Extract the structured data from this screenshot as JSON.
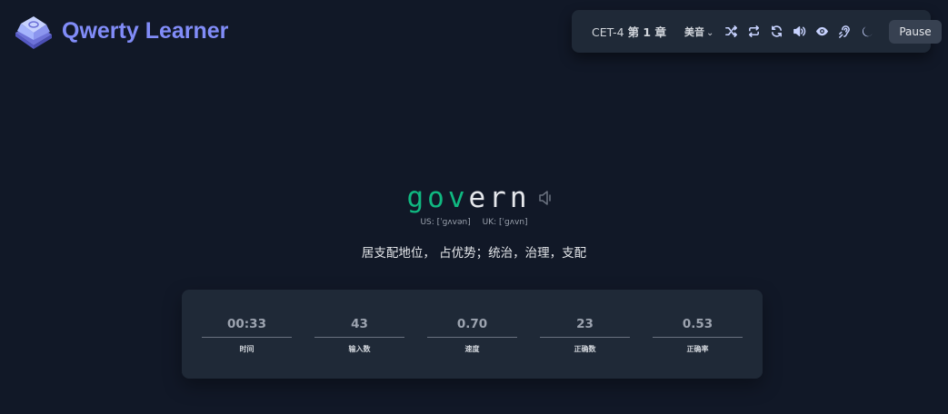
{
  "app": {
    "name": "Qwerty Learner",
    "accent_color": "#818cf8"
  },
  "toolbar": {
    "dictionary": "CET-4",
    "chapter": "第 1 章",
    "accent_label": "美音",
    "icons": [
      "shuffle-icon",
      "repeat-icon",
      "refresh-icon",
      "volume-icon",
      "eye-icon",
      "ear-icon",
      "moon-icon"
    ],
    "pause_label": "Pause"
  },
  "word": {
    "typed": "gov",
    "rest": "ern",
    "us_phonetic": "US: [ˈɡʌvən]",
    "uk_phonetic": "UK: [ˈɡʌvn]",
    "translation": "居支配地位， 占优势；统治，治理，支配",
    "typed_color": "#10b981"
  },
  "stats": [
    {
      "value": "00:33",
      "label": "时间"
    },
    {
      "value": "43",
      "label": "输入数"
    },
    {
      "value": "0.70",
      "label": "速度"
    },
    {
      "value": "23",
      "label": "正确数"
    },
    {
      "value": "0.53",
      "label": "正确率"
    }
  ]
}
